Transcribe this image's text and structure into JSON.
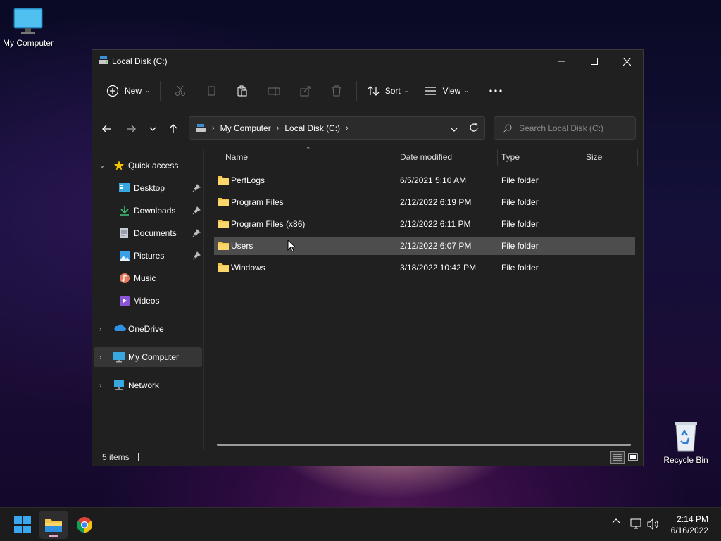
{
  "desktop": {
    "my_computer_label": "My Computer",
    "recycle_bin_label": "Recycle Bin"
  },
  "window": {
    "title": "Local Disk (C:)",
    "commandbar": {
      "new_label": "New",
      "sort_label": "Sort",
      "view_label": "View"
    },
    "address": {
      "crumbs": [
        "My Computer",
        "Local Disk (C:)"
      ]
    },
    "search": {
      "placeholder": "Search Local Disk (C:)"
    },
    "nav": {
      "quick_access": "Quick access",
      "items": [
        {
          "label": "Desktop",
          "pinned": true
        },
        {
          "label": "Downloads",
          "pinned": true
        },
        {
          "label": "Documents",
          "pinned": true
        },
        {
          "label": "Pictures",
          "pinned": true
        },
        {
          "label": "Music",
          "pinned": false
        },
        {
          "label": "Videos",
          "pinned": false
        }
      ],
      "onedrive": "OneDrive",
      "my_computer": "My Computer",
      "network": "Network"
    },
    "columns": {
      "name": "Name",
      "date": "Date modified",
      "type": "Type",
      "size": "Size"
    },
    "files": [
      {
        "name": "PerfLogs",
        "date": "6/5/2021 5:10 AM",
        "type": "File folder"
      },
      {
        "name": "Program Files",
        "date": "2/12/2022 6:19 PM",
        "type": "File folder"
      },
      {
        "name": "Program Files (x86)",
        "date": "2/12/2022 6:11 PM",
        "type": "File folder"
      },
      {
        "name": "Users",
        "date": "2/12/2022 6:07 PM",
        "type": "File folder",
        "selected": true
      },
      {
        "name": "Windows",
        "date": "3/18/2022 10:42 PM",
        "type": "File folder"
      }
    ],
    "status": {
      "items_count": "5 items"
    }
  },
  "taskbar": {
    "clock_time": "2:14 PM",
    "clock_date": "6/16/2022"
  },
  "colors": {
    "accent": "#0078d4",
    "folder": "#f3c64b",
    "selection": "#4d4d4d"
  }
}
